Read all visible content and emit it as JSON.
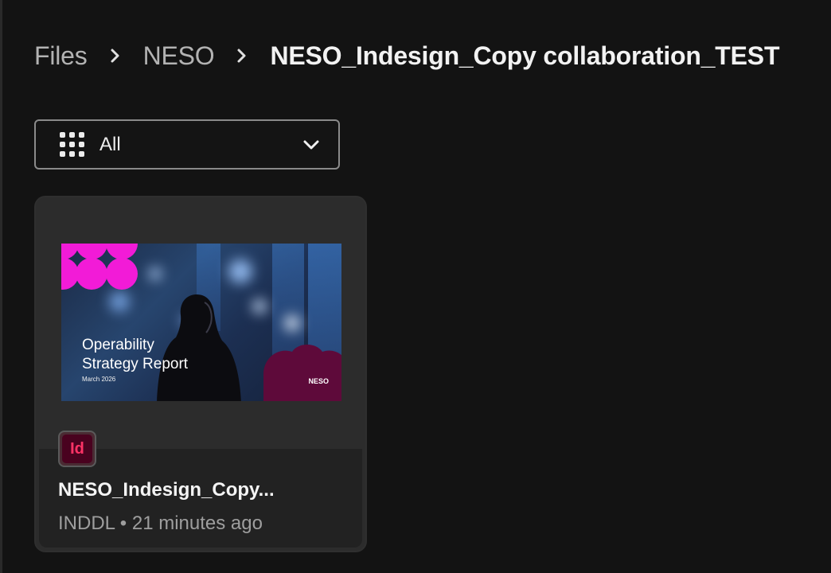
{
  "breadcrumb": {
    "items": [
      "Files",
      "NESO"
    ],
    "current": "NESO_Indesign_Copy collaboration_TEST"
  },
  "filter": {
    "label": "All",
    "icon": "grid-icon"
  },
  "card": {
    "thumbnail": {
      "title_line1": "Operability",
      "title_line2": "Strategy Report",
      "date": "March 2026",
      "logo_text": "NESO"
    },
    "app_badge": "Id",
    "file_name": "NESO_Indesign_Copy...",
    "file_meta": "INDDL • 21 minutes ago"
  },
  "colors": {
    "background": "#131313",
    "card": "#2c2c2c",
    "indesign_pink": "#ff3366",
    "indesign_bg": "#49021f",
    "accent_magenta": "#f21bd7"
  }
}
